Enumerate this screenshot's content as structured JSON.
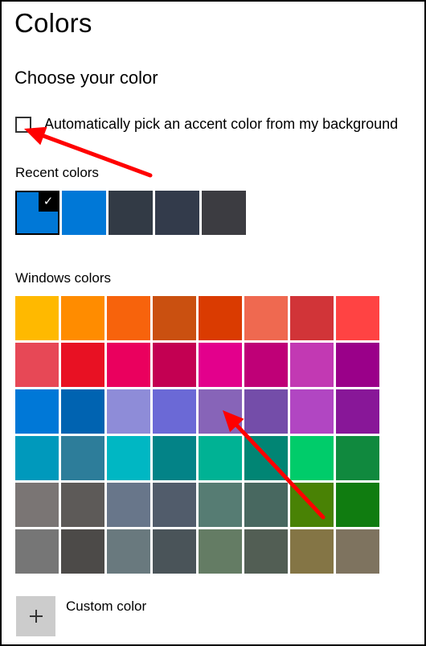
{
  "page": {
    "title": "Colors",
    "subtitle": "Choose your color"
  },
  "auto_accent": {
    "label": "Automatically pick an accent color from my background",
    "checked": false
  },
  "recent": {
    "label": "Recent colors",
    "swatches": [
      {
        "color": "#0078d7",
        "selected": true,
        "check_icon": "✓"
      },
      {
        "color": "#0078d7",
        "selected": false
      },
      {
        "color": "#323a45",
        "selected": false
      },
      {
        "color": "#333b4b",
        "selected": false
      },
      {
        "color": "#3c3c41",
        "selected": false
      }
    ]
  },
  "windows_colors": {
    "label": "Windows colors",
    "rows": [
      [
        "#ffb900",
        "#ff8c00",
        "#f7630c",
        "#ca5010",
        "#da3b01",
        "#ef6950",
        "#d13438",
        "#ff4343"
      ],
      [
        "#e74856",
        "#e81123",
        "#ea005e",
        "#c30052",
        "#e3008c",
        "#bf0077",
        "#c239b3",
        "#9a0089"
      ],
      [
        "#0078d7",
        "#0063b1",
        "#8e8cd8",
        "#6b69d6",
        "#8764b8",
        "#744da9",
        "#b146c2",
        "#881798"
      ],
      [
        "#0099bc",
        "#2d7d9a",
        "#00b7c3",
        "#038387",
        "#00b294",
        "#018574",
        "#00cc6a",
        "#10893e"
      ],
      [
        "#7a7574",
        "#5d5a58",
        "#68768a",
        "#515c6b",
        "#567c73",
        "#486860",
        "#498205",
        "#107c10"
      ],
      [
        "#767676",
        "#4c4a48",
        "#69797e",
        "#4a5459",
        "#647c64",
        "#525e54",
        "#847545",
        "#7e735f"
      ]
    ]
  },
  "custom_color": {
    "label": "Custom color",
    "icon": "plus-icon"
  },
  "annotations": {
    "arrow_color": "#ff0000"
  }
}
